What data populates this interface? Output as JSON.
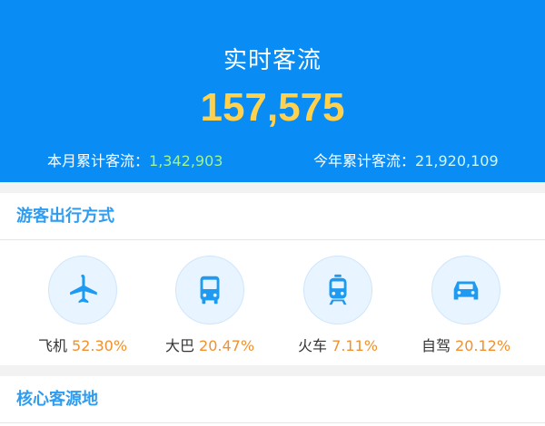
{
  "header": {
    "title": "实时客流",
    "total": "157,575",
    "month_label": "本月累计客流：",
    "month_value": "1,342,903",
    "year_label": "今年累计客流：",
    "year_value": "21,920,109"
  },
  "travel": {
    "title": "游客出行方式",
    "modes": [
      {
        "name": "飞机",
        "percent": "52.30%",
        "icon": "airplane-icon"
      },
      {
        "name": "大巴",
        "percent": "20.47%",
        "icon": "bus-icon"
      },
      {
        "name": "火车",
        "percent": "7.11%",
        "icon": "train-icon"
      },
      {
        "name": "自驾",
        "percent": "20.12%",
        "icon": "car-icon"
      }
    ]
  },
  "source": {
    "title": "核心客源地"
  },
  "colors": {
    "header_bg": "#0a8cf5",
    "total": "#ffd14d",
    "accent": "#2f9cf0",
    "percent": "#f0902f",
    "icon": "#1e9bf0"
  }
}
